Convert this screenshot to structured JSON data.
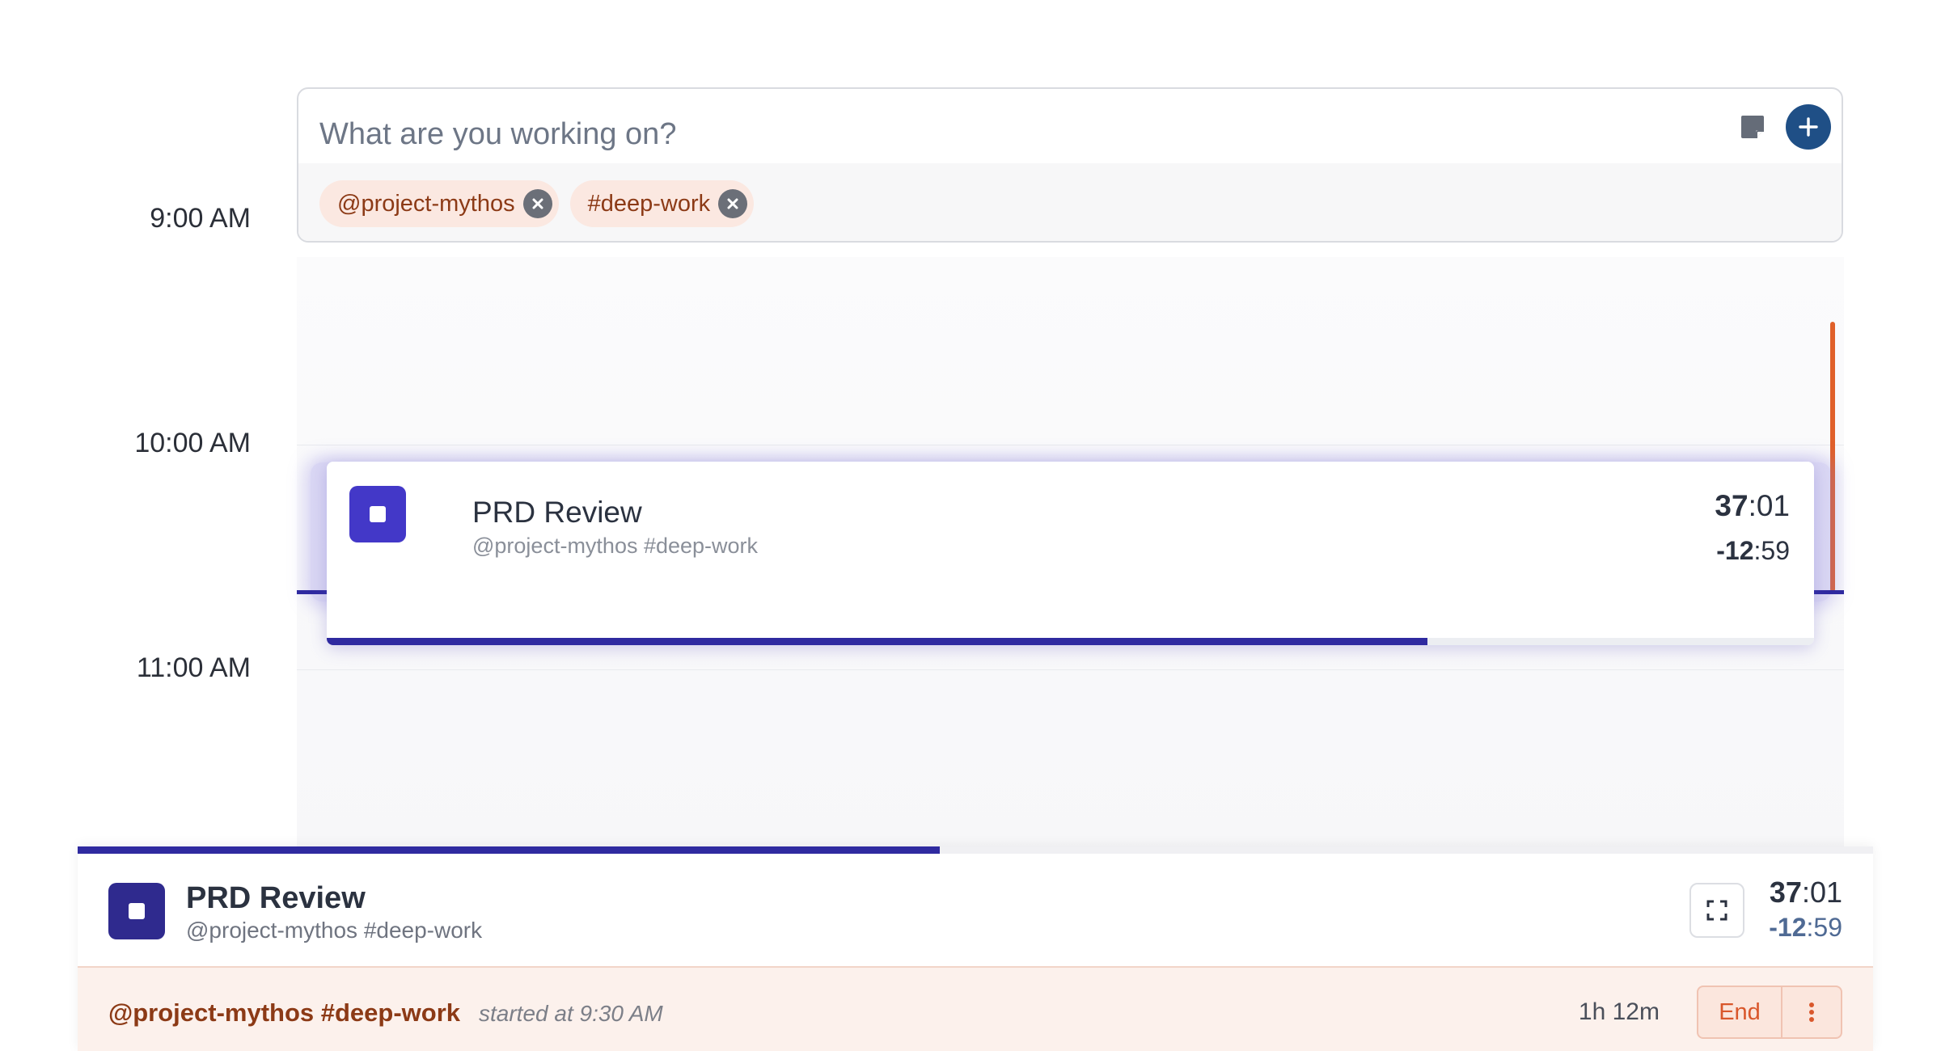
{
  "entry": {
    "placeholder": "What are you working on?",
    "value": "",
    "note_icon": "sticky-note-icon",
    "add_icon": "plus-icon",
    "tags": [
      {
        "label": "@project-mythos",
        "remove_icon": "close-icon"
      },
      {
        "label": "#deep-work",
        "remove_icon": "close-icon"
      }
    ]
  },
  "timeline": {
    "hours": [
      "9:00 AM",
      "10:00 AM",
      "11:00 AM"
    ]
  },
  "active_event": {
    "title": "PRD Review",
    "tags": "@project-mythos #deep-work",
    "elapsed_main": "37",
    "elapsed_rest": ":01",
    "remaining_main": "-12",
    "remaining_rest": ":59",
    "progress": 0.74,
    "stop_icon": "stop-icon"
  },
  "tracker_bar": {
    "title": "PRD Review",
    "tags": "@project-mythos #deep-work",
    "elapsed_main": "37",
    "elapsed_rest": ":01",
    "remaining_main": "-12",
    "remaining_rest": ":59",
    "progress": 0.48,
    "expand_icon": "expand-icon",
    "session": {
      "tags": "@project-mythos #deep-work",
      "started": "started at 9:30 AM",
      "duration": "1h 12m",
      "end_label": "End",
      "more_icon": "more-vertical-icon"
    }
  },
  "colors": {
    "accent": "#2f2aa0",
    "stop_button": "#4338c8",
    "add_button": "#1f4f86",
    "tag_text": "#8c3a16",
    "tag_bg": "#fbe8e1",
    "now_marker": "#e0602a"
  }
}
